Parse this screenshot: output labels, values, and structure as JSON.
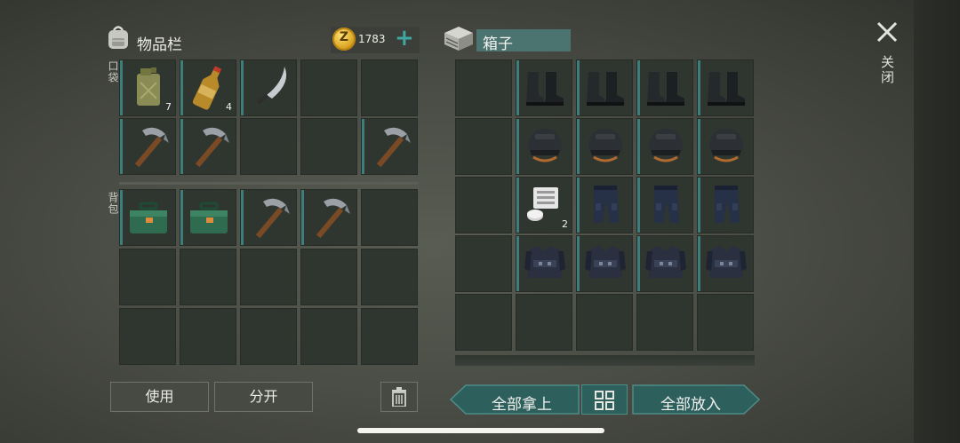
{
  "inventory": {
    "title": "物品栏",
    "icon": "backpack-icon",
    "coins": "1783",
    "coin_symbol": "Z",
    "pocket_label": "口袋",
    "backpack_label": "背包",
    "pocket_items": [
      {
        "name": "jerrycan",
        "qty": "7"
      },
      {
        "name": "bottle",
        "qty": "4"
      },
      {
        "name": "machete",
        "qty": ""
      },
      null,
      null,
      {
        "name": "pickaxe",
        "qty": ""
      },
      {
        "name": "pickaxe",
        "qty": ""
      },
      null,
      null,
      {
        "name": "pickaxe",
        "qty": ""
      }
    ],
    "backpack_items": [
      {
        "name": "toolbox",
        "qty": ""
      },
      {
        "name": "toolbox",
        "qty": ""
      },
      {
        "name": "pickaxe",
        "qty": ""
      },
      {
        "name": "pickaxe",
        "qty": ""
      },
      null,
      null,
      null,
      null,
      null,
      null,
      null,
      null,
      null,
      null,
      null
    ]
  },
  "box": {
    "title": "箱子",
    "icon": "crate-icon",
    "rows": [
      [
        null,
        {
          "name": "boots"
        },
        {
          "name": "boots"
        },
        {
          "name": "boots"
        },
        {
          "name": "boots"
        }
      ],
      [
        null,
        {
          "name": "helmet"
        },
        {
          "name": "helmet"
        },
        {
          "name": "helmet"
        },
        {
          "name": "helmet"
        }
      ],
      [
        null,
        {
          "name": "engine-part",
          "qty": "2"
        },
        {
          "name": "pants"
        },
        {
          "name": "pants"
        },
        {
          "name": "pants"
        }
      ],
      [
        null,
        {
          "name": "vest"
        },
        {
          "name": "vest"
        },
        {
          "name": "vest"
        },
        {
          "name": "vest"
        }
      ],
      [
        null,
        null,
        null,
        null,
        null
      ]
    ]
  },
  "buttons": {
    "use": "使用",
    "split": "分开",
    "take_all": "全部拿上",
    "put_all": "全部放入"
  },
  "close": {
    "label": "关闭"
  },
  "colors": {
    "accent": "#3c7e7c",
    "button_teal": "#2d5f5c",
    "coin": "#d9a420"
  }
}
